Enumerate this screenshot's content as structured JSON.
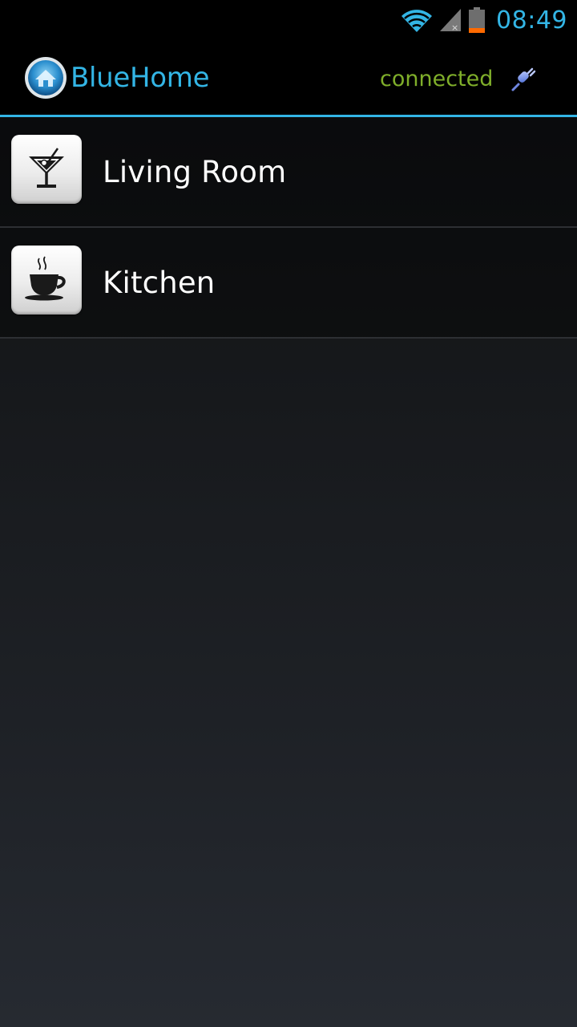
{
  "status_bar": {
    "time": "08:49",
    "icons": [
      "wifi-icon",
      "cell-signal-icon",
      "battery-icon"
    ],
    "accent_color": "#33b5e5",
    "battery_level_color": "#ff6a00"
  },
  "action_bar": {
    "title": "BlueHome",
    "connection_status": "connected",
    "connection_status_color": "#7fae2a",
    "bluetooth_icon": "bluetooth-plug-icon",
    "logo_icon": "bluehome-logo-icon"
  },
  "rooms": [
    {
      "name": "Living Room",
      "icon": "cocktail-icon"
    },
    {
      "name": "Kitchen",
      "icon": "coffee-cup-icon"
    }
  ]
}
